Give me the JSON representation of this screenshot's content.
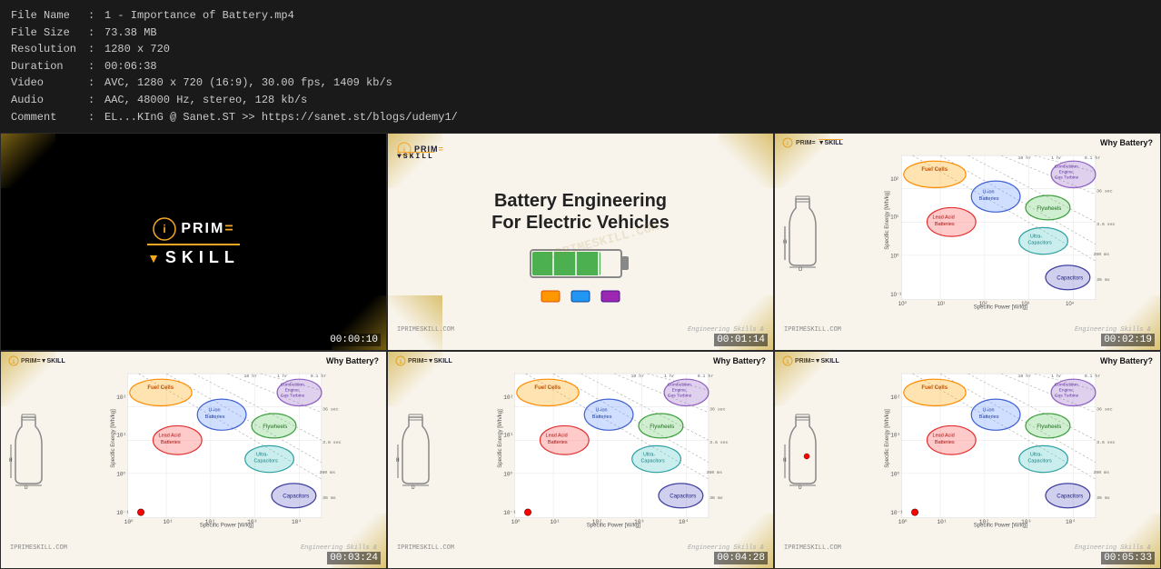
{
  "metadata": {
    "file_name_label": "File Name",
    "file_name_value": "1 - Importance of Battery.mp4",
    "file_size_label": "File Size",
    "file_size_value": "73.38 MB",
    "resolution_label": "Resolution",
    "resolution_value": "1280 x 720",
    "duration_label": "Duration",
    "duration_value": "00:06:38",
    "video_label": "Video",
    "video_value": "AVC, 1280 x 720 (16:9), 30.00 fps, 1409 kb/s",
    "audio_label": "Audio",
    "audio_value": "AAC, 48000 Hz, stereo, 128 kb/s",
    "comment_label": "Comment",
    "comment_value": "EL...KInG @ Sanet.ST >> https://sanet.st/blogs/udemy1/",
    "sep": ":"
  },
  "thumbnails": [
    {
      "id": 1,
      "type": "logo",
      "timestamp": "00:00:10"
    },
    {
      "id": 2,
      "type": "battery_slide",
      "title_line1": "Battery Engineering",
      "title_line2": "For Electric Vehicles",
      "timestamp": "00:01:14",
      "footer_left": "IPRIMESKILL.COM",
      "footer_right": "Engineering Skills &"
    },
    {
      "id": 3,
      "type": "chart_slide",
      "why_battery": "Why Battery?",
      "timestamp": "00:02:19",
      "footer_left": "IPRIMESKILL.COM",
      "footer_right": "Engineering Skills &"
    },
    {
      "id": 4,
      "type": "chart_slide",
      "why_battery": "Why Battery?",
      "timestamp": "00:03:24",
      "footer_left": "IPRIMESKILL.COM",
      "footer_right": "Engineering Skills &"
    },
    {
      "id": 5,
      "type": "chart_slide",
      "why_battery": "Why Battery?",
      "timestamp": "00:04:28",
      "footer_left": "IPRIMESKILL.COM",
      "footer_right": "Engineering Skills &"
    },
    {
      "id": 6,
      "type": "chart_slide",
      "why_battery": "Why Battery?",
      "timestamp": "00:05:33",
      "footer_left": "IPRIMESKILL.COM",
      "footer_right": "Engineering Skills &"
    }
  ],
  "logo": {
    "top": "iPRIM≡",
    "bottom": "▼SKILL"
  }
}
